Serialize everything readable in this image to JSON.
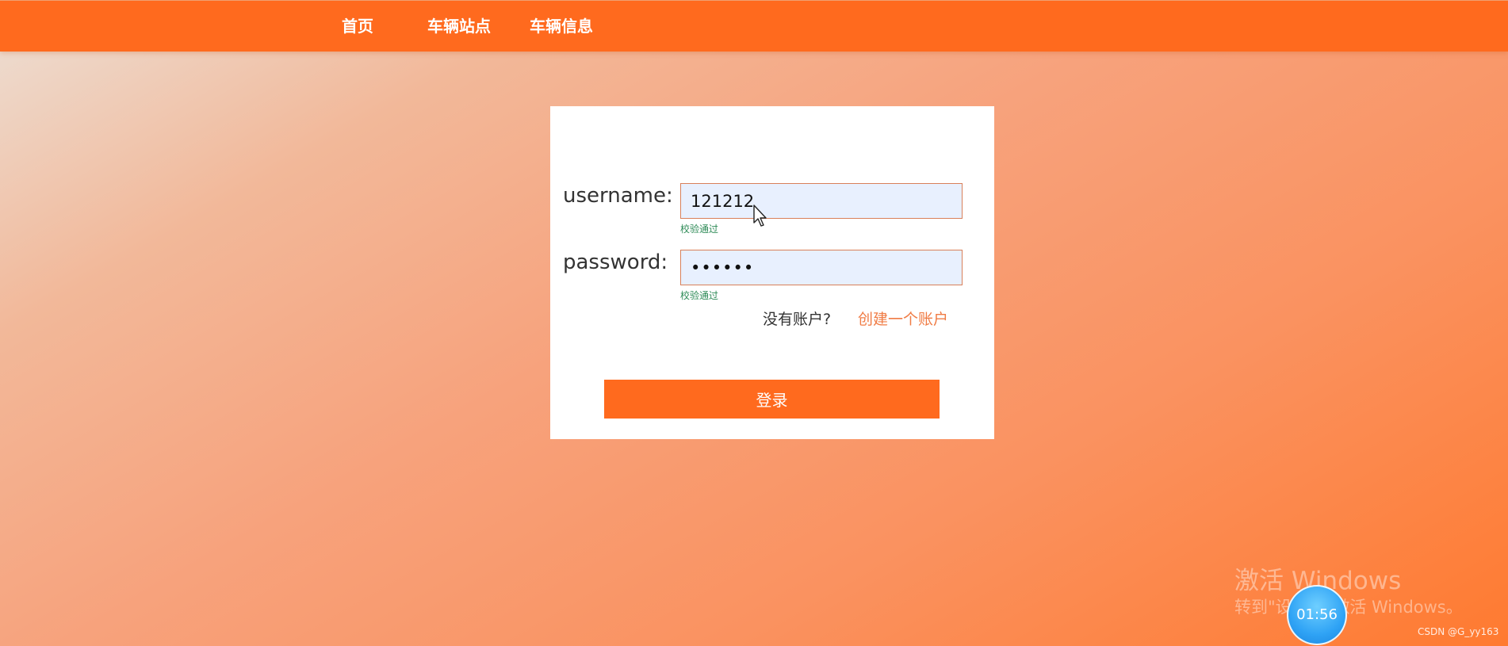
{
  "nav": {
    "items": [
      {
        "label": "首页"
      },
      {
        "label": "车辆站点"
      },
      {
        "label": "车辆信息"
      }
    ]
  },
  "login_form": {
    "username_label": "username:",
    "username_value": "121212",
    "username_validation": "校验通过",
    "password_label": "password:",
    "password_value": "••••••",
    "password_validation": "校验通过",
    "no_account_text": "没有账户?",
    "register_link": "创建一个账户",
    "login_button": "登录"
  },
  "overlay": {
    "watermark_title": "激活 Windows",
    "watermark_subtitle": "转到\"设置\"以激活 Windows。",
    "timer": "01:56",
    "credit": "CSDN @G_yy163"
  },
  "colors": {
    "primary": "#ff6a1e",
    "link": "#f07c45",
    "validation": "#2e8b57",
    "input_bg": "#e8f0fe"
  }
}
